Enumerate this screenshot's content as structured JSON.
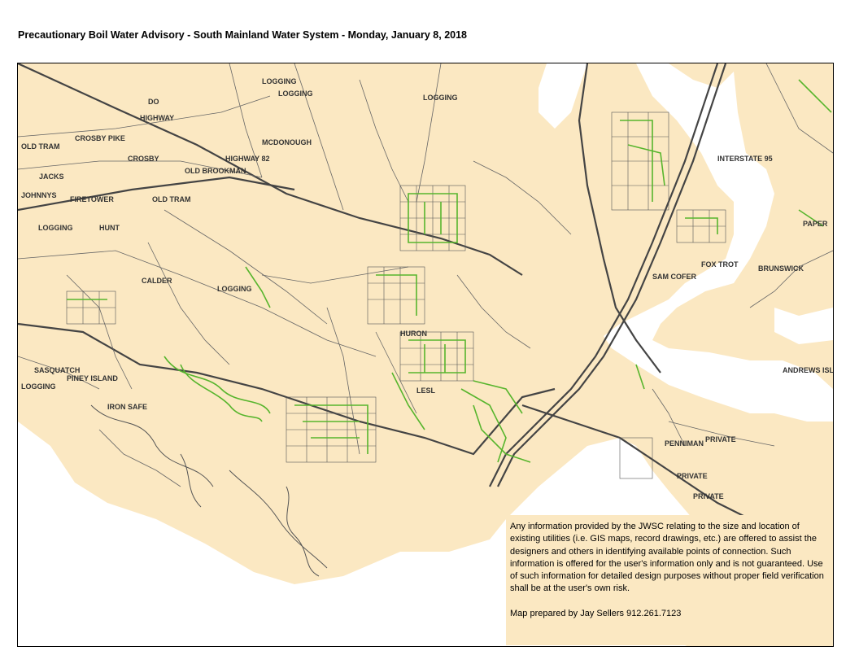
{
  "title": "Precautionary Boil Water Advisory - South Mainland Water System - Monday, January 8, 2018",
  "colors": {
    "land": "#fbe8c2",
    "water": "#ffffff",
    "road": "#444444",
    "water_main": "#57b52d",
    "text": "#000000"
  },
  "road_labels": [
    "OLD TRAM",
    "CROSBY PIKE",
    "DO",
    "HIGHWAY",
    "CROSBY",
    "JACKS",
    "JOHNNYS",
    "FIRETOWER",
    "OLD BROOKMAN",
    "HIGHWAY 82",
    "OLD TRAM",
    "LOGGING",
    "HUNT",
    "LOGGING",
    "MCDONOUGH",
    "LOGGING",
    "LOGGING",
    "CALDER",
    "LOGGING",
    "IRON SAFE",
    "SASQUATCH",
    "PINEY ISLAND",
    "LOGGING",
    "INTERSTATE 95",
    "HURON",
    "LESL",
    "SAM COFER",
    "FOX TROT",
    "BRUNSWICK",
    "PAPER",
    "ANDREWS ISLAND",
    "PENNIMAN",
    "PRIVATE",
    "PRIVATE",
    "PRIVATE"
  ],
  "disclaimer": {
    "text": "Any information provided by the JWSC relating to the size and location of existing utilities (i.e. GIS maps, record drawings, etc.) are offered to assist the designers and others in identifying available points of connection. Such information is offered for the user's information only and is not guaranteed. Use of such information for detailed design purposes without proper field verification shall be at the user's own risk.",
    "credit": "Map prepared by Jay Sellers 912.261.7123"
  }
}
